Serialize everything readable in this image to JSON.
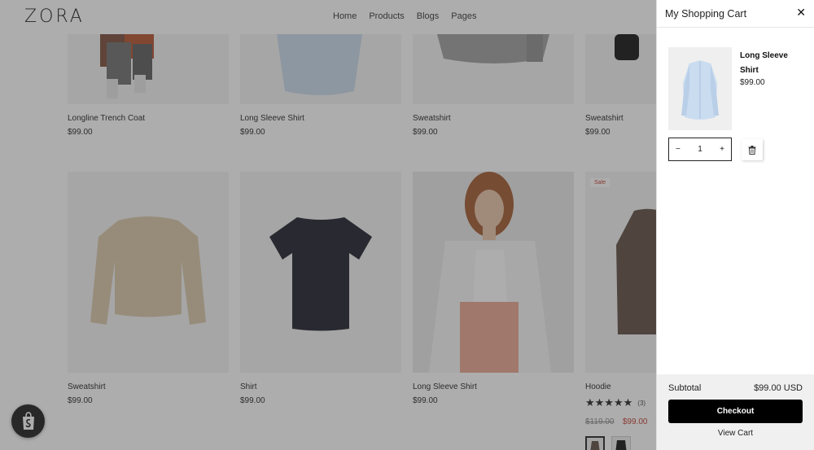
{
  "header": {
    "logo": "ZORA",
    "nav": [
      "Home",
      "Products",
      "Blogs",
      "Pages"
    ]
  },
  "products_row1": [
    {
      "name": "Longline Trench Coat",
      "price": "$99.00"
    },
    {
      "name": "Long Sleeve Shirt",
      "price": "$99.00"
    },
    {
      "name": "Sweatshirt",
      "price": "$99.00"
    },
    {
      "name": "Sweatshirt",
      "price": "$99.00"
    }
  ],
  "products_row2": [
    {
      "name": "Sweatshirt",
      "price": "$99.00"
    },
    {
      "name": "Shirt",
      "price": "$99.00"
    },
    {
      "name": "Long Sleeve Shirt",
      "price": "$99.00"
    },
    {
      "name": "Hoodie",
      "badge": "Sale",
      "stars": "★★★★★",
      "rating_count": "(3)",
      "old_price": "$119.00",
      "price": "$99.00"
    }
  ],
  "cart": {
    "title": "My Shopping Cart",
    "close_icon": "close-icon",
    "item": {
      "name": "Long Sleeve Shirt",
      "price": "$99.00",
      "quantity": "1",
      "minus": "−",
      "plus": "+"
    },
    "subtotal_label": "Subtotal",
    "subtotal_value": "$99.00 USD",
    "checkout_label": "Checkout",
    "view_cart_label": "View Cart"
  },
  "colors": {
    "accent": "#000000",
    "sale": "#c0392b",
    "overlay": "rgba(60,60,60,0.42)"
  }
}
